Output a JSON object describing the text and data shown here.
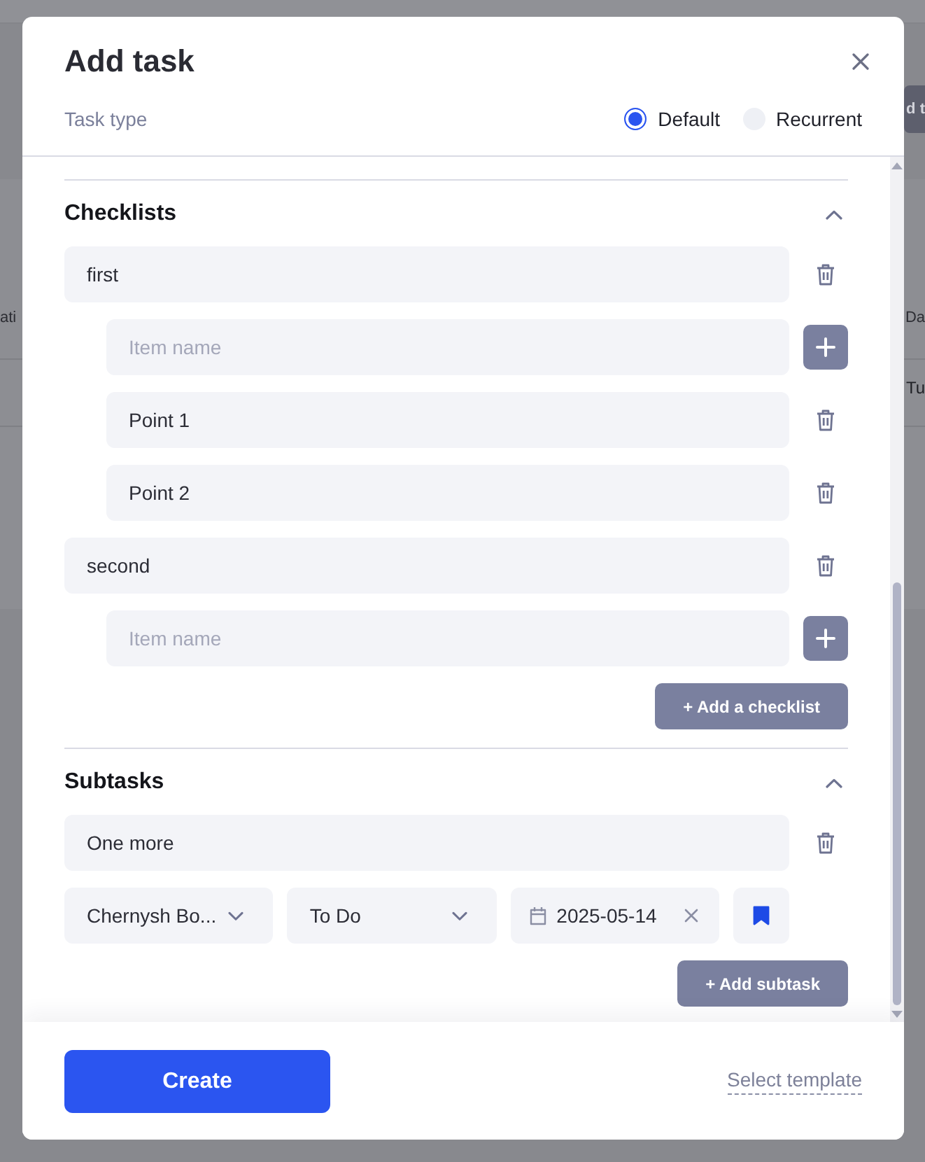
{
  "background_page": {
    "toolbar_button": "d t",
    "table": {
      "columns": [
        "ati",
        "Da"
      ],
      "rows": [
        {
          "column_2": "Tu"
        }
      ]
    }
  },
  "dialog": {
    "title": "Add task"
  },
  "task_type": {
    "label": "Task type",
    "options": [
      {
        "label": "Default",
        "selected": true
      },
      {
        "label": "Recurrent",
        "selected": false
      }
    ]
  },
  "checklists": {
    "title": "Checklists",
    "expanded": true,
    "lists": [
      {
        "name": "first",
        "new_item": {
          "placeholder": "Item name"
        },
        "items": [
          {
            "name": "Point 1"
          },
          {
            "name": "Point 2"
          }
        ]
      },
      {
        "name": "second",
        "new_item": {
          "placeholder": "Item name"
        }
      }
    ],
    "add_button": "+ Add a checklist"
  },
  "subtasks": {
    "title": "Subtasks",
    "expanded": true,
    "items": [
      {
        "name": "One more",
        "assignee": "Chernysh Bo...",
        "status": "To Do",
        "due_date": "2025-05-14",
        "bookmarked": true
      }
    ],
    "add_button": "+ Add subtask"
  },
  "footer": {
    "create_button": "Create",
    "template_link": "Select template"
  }
}
